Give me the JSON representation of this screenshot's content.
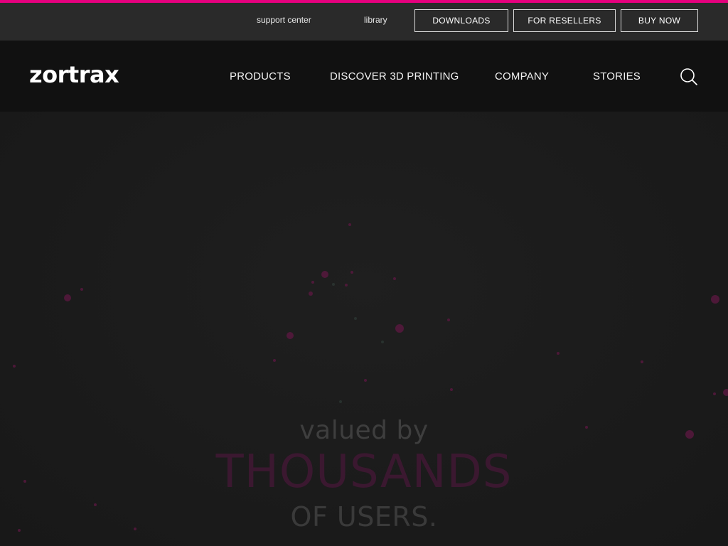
{
  "topbar": {
    "support_label": "support center",
    "library_label": "library",
    "downloads_label": "DOWNLOADS",
    "resellers_label": "FOR RESELLERS",
    "buy_label": "BUY NOW"
  },
  "header": {
    "logo_text": "zortrax",
    "nav": {
      "products": "PRODUCTS",
      "discover": "DISCOVER 3D PRINTING",
      "company": "COMPANY",
      "stories": "STORIES"
    },
    "search_icon": "search-icon"
  },
  "hero": {
    "line1": "valued by",
    "line2": "THOUSANDS",
    "line3": "OF USERS."
  },
  "colors": {
    "accent": "#e6007e",
    "topbar_bg": "#2a2a2a",
    "nav_bg": "#111111",
    "hero_bg": "#1b1b1b"
  }
}
